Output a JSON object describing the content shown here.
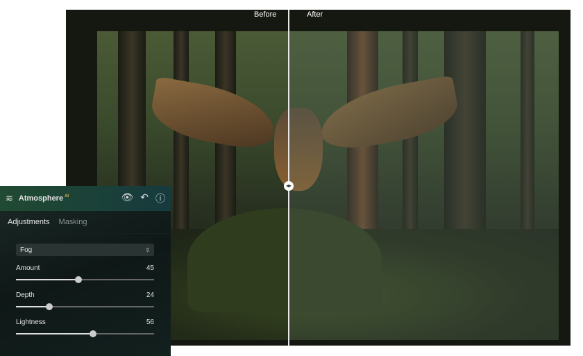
{
  "compare": {
    "before_label": "Before",
    "after_label": "After"
  },
  "panel": {
    "title": "Atmosphere",
    "badge": "AI",
    "tabs": [
      {
        "label": "Adjustments",
        "active": true
      },
      {
        "label": "Masking",
        "active": false
      }
    ],
    "preset": "Fog",
    "sliders": [
      {
        "label": "Amount",
        "value": 45,
        "fraction": 0.45
      },
      {
        "label": "Depth",
        "value": 24,
        "fraction": 0.24
      },
      {
        "label": "Lightness",
        "value": 56,
        "fraction": 0.56
      }
    ]
  }
}
